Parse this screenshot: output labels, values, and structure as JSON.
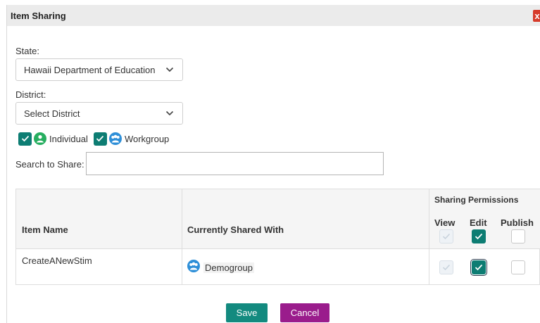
{
  "dialog": {
    "title": "Item Sharing",
    "close_glyph": "x"
  },
  "state": {
    "label": "State:",
    "selected": "Hawaii Department of Education"
  },
  "district": {
    "label": "District:",
    "selected": "Select District"
  },
  "filters": {
    "individual": {
      "label": "Individual",
      "checked": true,
      "icon": "person-icon"
    },
    "workgroup": {
      "label": "Workgroup",
      "checked": true,
      "icon": "group-icon"
    }
  },
  "search": {
    "label": "Search to Share:",
    "value": ""
  },
  "table": {
    "headers": {
      "item_name": "Item Name",
      "shared_with": "Currently Shared With",
      "permissions": "Sharing Permissions",
      "view": "View",
      "edit": "Edit",
      "publish": "Publish"
    },
    "header_checks": {
      "view": "disabled",
      "edit": true,
      "publish": false
    },
    "rows": [
      {
        "item_name": "CreateANewStim",
        "shared_with": "Demogroup",
        "shared_icon": "group-icon",
        "view": "disabled",
        "edit": true,
        "publish": false
      }
    ]
  },
  "buttons": {
    "save": "Save",
    "cancel": "Cancel"
  },
  "colors": {
    "checkbox_checked": "#0d7d73",
    "save_button": "#138a7f",
    "cancel_button": "#9a1c8c",
    "close_button": "#d63b2b",
    "person_icon": "#27ae60",
    "group_icon": "#2e8fd8"
  }
}
